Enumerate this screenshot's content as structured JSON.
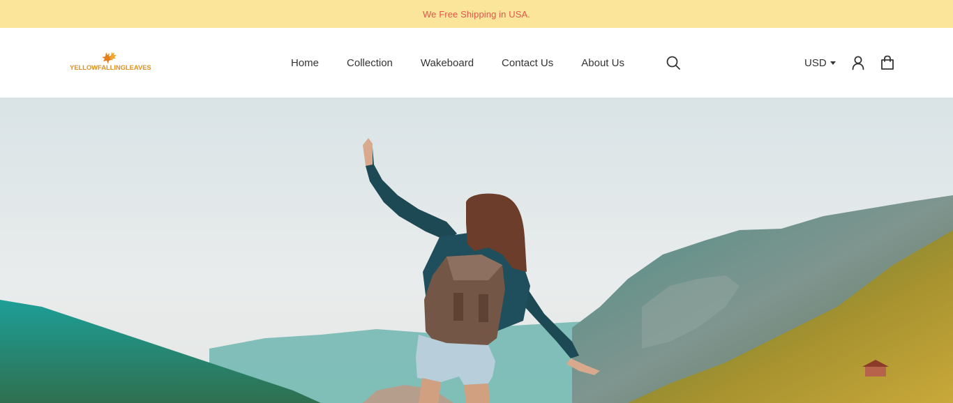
{
  "announcement": {
    "text": "We Free Shipping in USA."
  },
  "brand": {
    "name": "YELLOWFALLINGLEAVES",
    "color": "#e0901b"
  },
  "nav": {
    "items": [
      {
        "label": "Home"
      },
      {
        "label": "Collection"
      },
      {
        "label": "Wakeboard"
      },
      {
        "label": "Contact Us"
      },
      {
        "label": "About Us"
      }
    ]
  },
  "header_actions": {
    "currency": "USD",
    "search_icon": "search-icon",
    "account_icon": "user-icon",
    "cart_icon": "shopping-bag-icon"
  },
  "colors": {
    "announcement_bg": "#fbe59a",
    "announcement_text": "#e2574a",
    "nav_text": "#333333"
  },
  "hero": {
    "image": "woman-with-backpack-raising-arms-over-mountain-valley"
  }
}
